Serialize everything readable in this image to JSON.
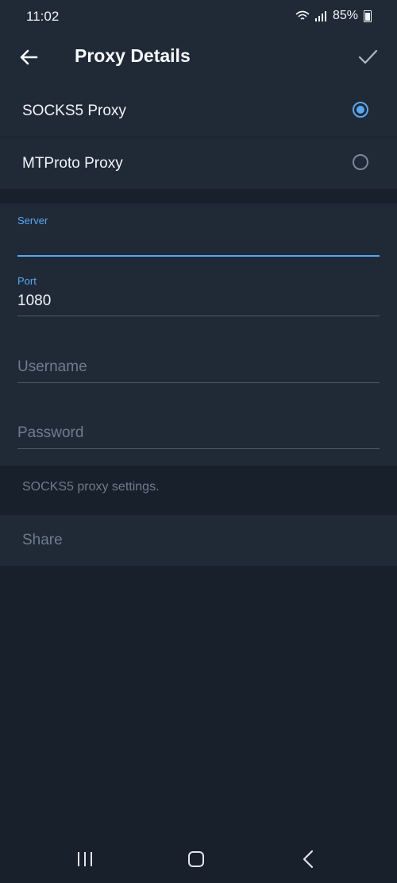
{
  "status_bar": {
    "time": "11:02",
    "battery": "85%",
    "icons": [
      "wifi-icon",
      "signal-icon",
      "battery-icon"
    ]
  },
  "app_bar": {
    "title": "Proxy Details",
    "icons": [
      "back-arrow-icon",
      "check-icon"
    ]
  },
  "proxy_types": [
    {
      "label": "SOCKS5 Proxy",
      "selected": true
    },
    {
      "label": "MTProto Proxy",
      "selected": false
    }
  ],
  "fields": {
    "server": {
      "label": "Server",
      "value": "",
      "focused": true
    },
    "port": {
      "label": "Port",
      "value": "1080"
    },
    "username": {
      "placeholder": "Username"
    },
    "password": {
      "placeholder": "Password"
    }
  },
  "hint": "SOCKS5 proxy settings.",
  "share_label": "Share",
  "colors": {
    "background": "#18202b",
    "surface": "#202a37",
    "accent": "#5aa6ef",
    "text": "#f1f4f7",
    "muted": "#6f7c8b"
  },
  "nav_bar": {
    "icons": [
      "recent-apps-icon",
      "home-icon",
      "back-icon"
    ]
  }
}
